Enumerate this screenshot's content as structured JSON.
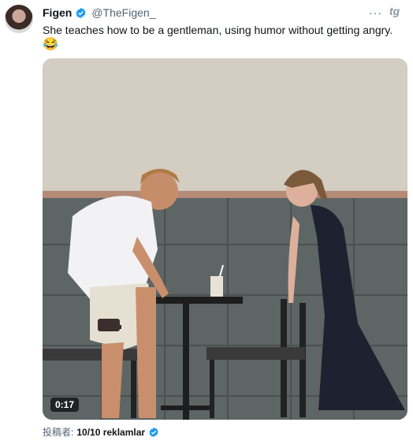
{
  "tweet": {
    "display_name": "Figen",
    "handle": "@TheFigen_",
    "text": "She teaches how to be a gentleman, using humor without getting angry.",
    "emoji": "😂",
    "more_icon": "···",
    "brand_icon": "tg"
  },
  "video": {
    "timestamp": "0:17"
  },
  "footer": {
    "label": "投稿者:",
    "poster": "10/10 reklamlar"
  },
  "colors": {
    "verified": "#1d9bf0",
    "secondary_text": "#536471"
  }
}
